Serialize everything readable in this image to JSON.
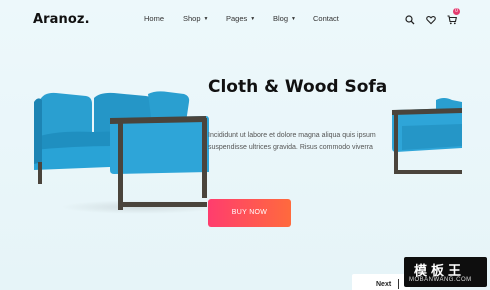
{
  "header": {
    "logo": "Aranoz.",
    "nav": [
      {
        "label": "Home",
        "has_dropdown": false
      },
      {
        "label": "Shop",
        "has_dropdown": true
      },
      {
        "label": "Pages",
        "has_dropdown": true
      },
      {
        "label": "Blog",
        "has_dropdown": true
      },
      {
        "label": "Contact",
        "has_dropdown": false
      }
    ],
    "icons": [
      "search-icon",
      "heart-icon",
      "cart-icon"
    ],
    "cart_count": "0"
  },
  "hero": {
    "title": "Cloth & Wood Sofa",
    "description": "Incididunt ut labore et dolore magna aliqua quis ipsum suspendisse ultrices gravida. Risus commodo viverra",
    "button_label": "BUY NOW"
  },
  "slider": {
    "next_label": "Next"
  },
  "watermark": {
    "main": "模板王",
    "sub": "MOBANWANG.COM"
  },
  "colors": {
    "background": "#eaf6fa",
    "sofa_blue": "#2a9fd0",
    "sofa_frame": "#4a443c",
    "button_gradient_start": "#ff3d6e",
    "button_gradient_end": "#ff6a3d",
    "badge": "#e33b6f"
  }
}
